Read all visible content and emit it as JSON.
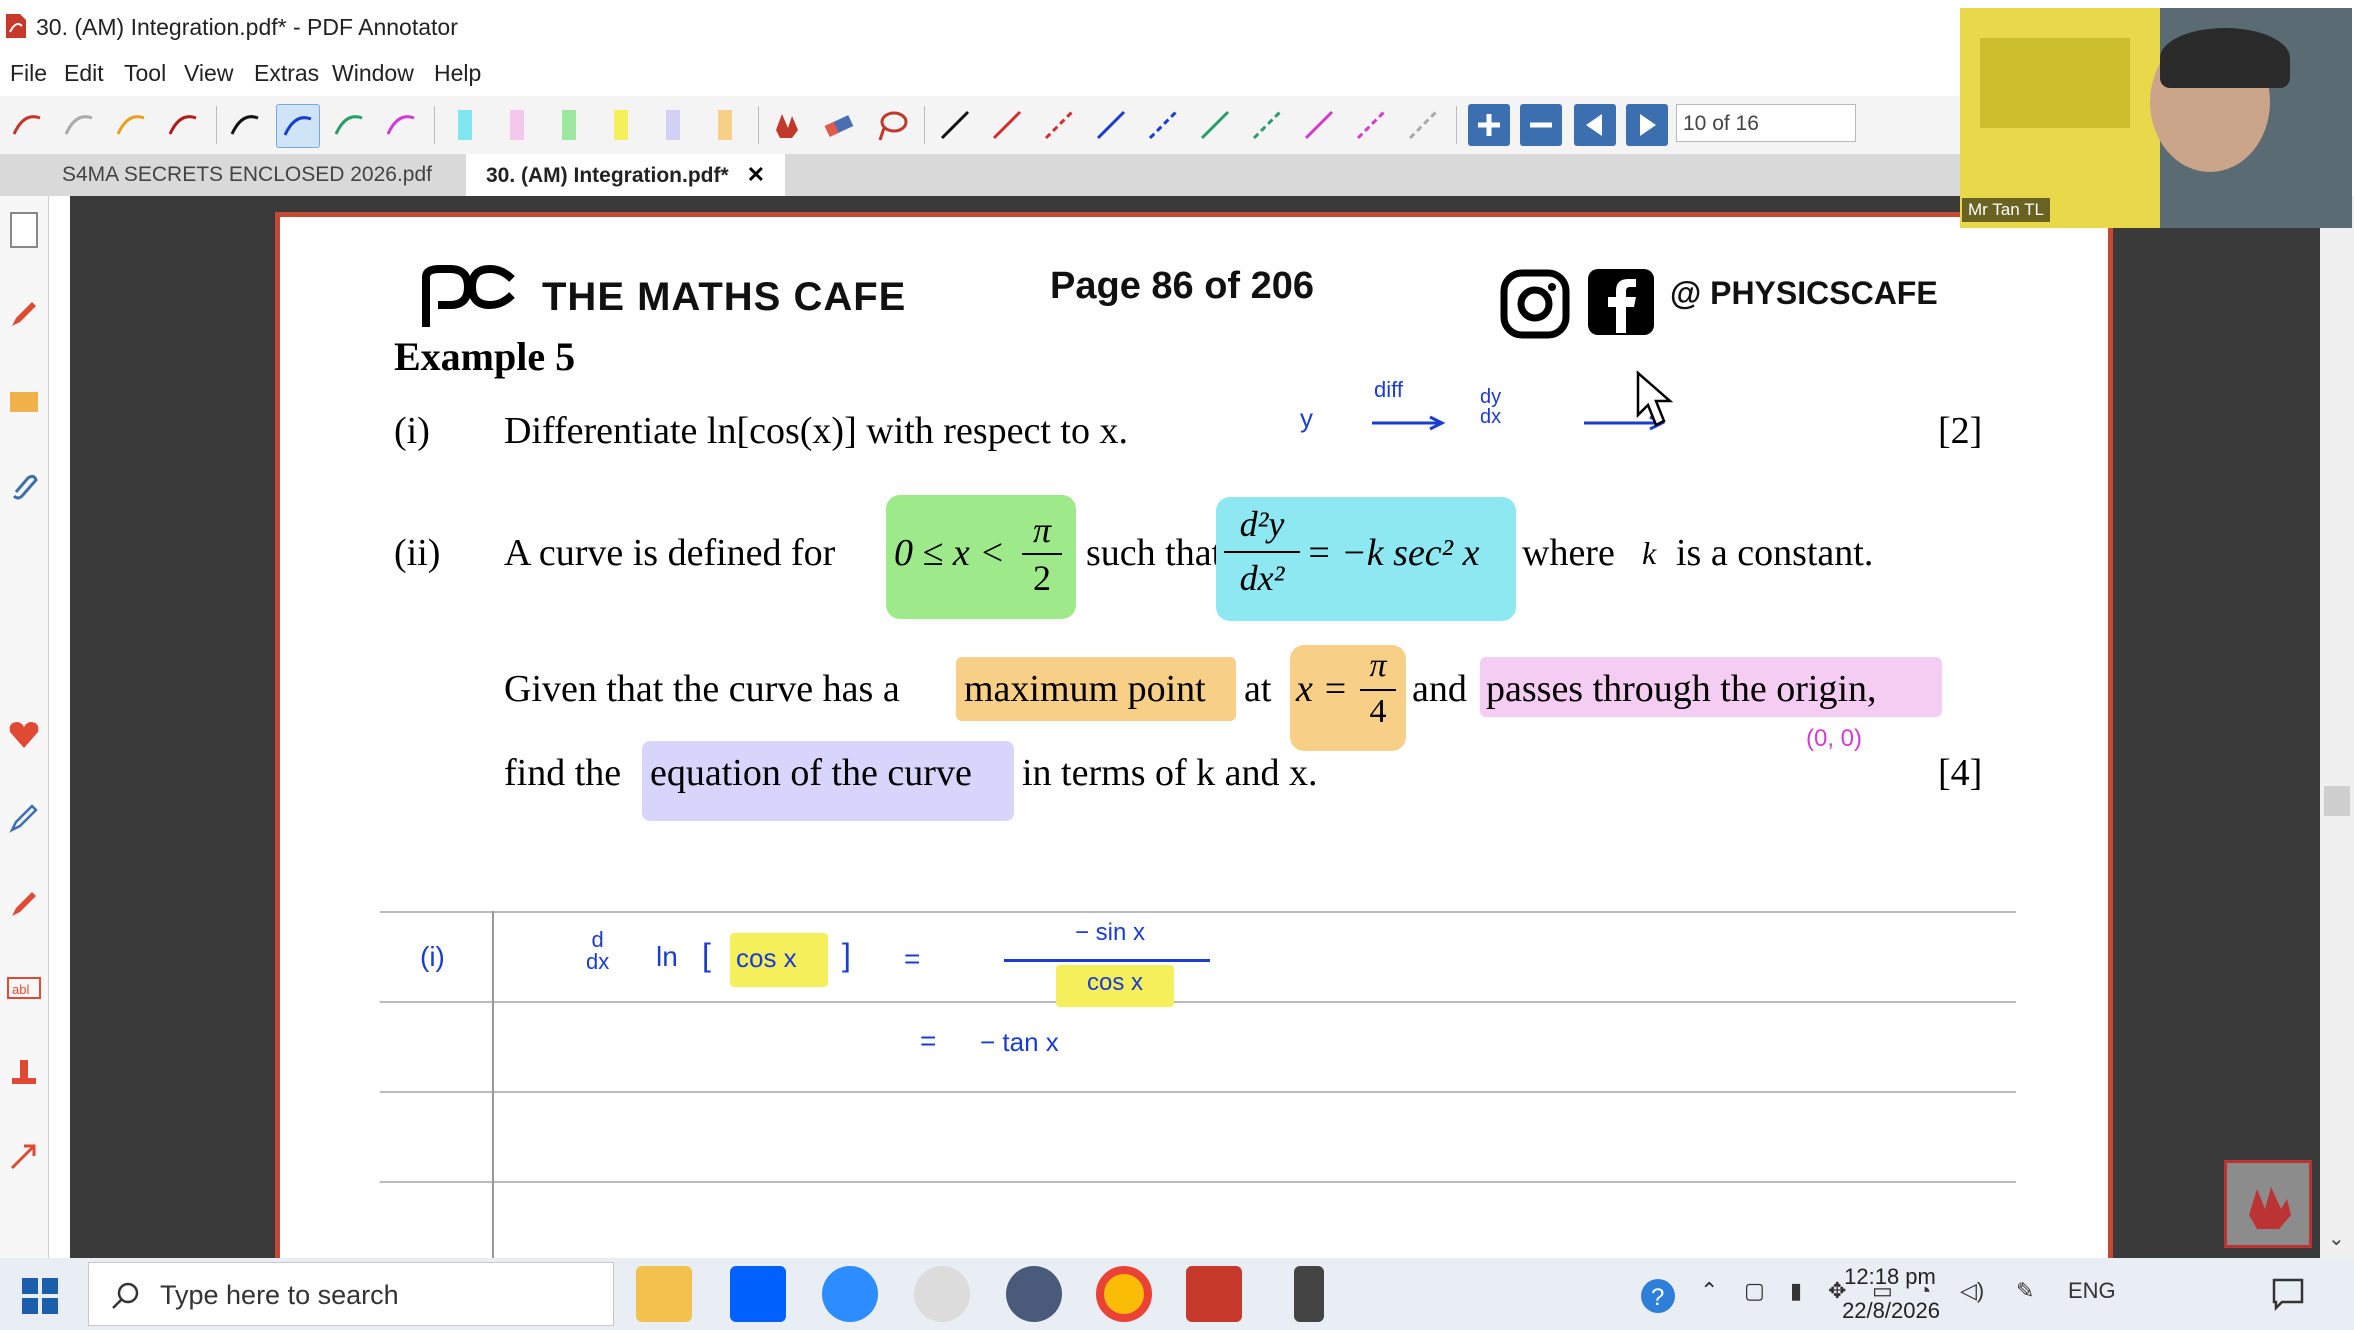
{
  "window": {
    "title": "30. (AM) Integration.pdf* - PDF Annotator"
  },
  "menu": [
    "File",
    "Edit",
    "Tool",
    "View",
    "Extras",
    "Window",
    "Help"
  ],
  "toolbar": {
    "page_indicator": "10 of 16"
  },
  "tabs": [
    {
      "label": "S4MA SECRETS ENCLOSED 2026.pdf"
    },
    {
      "label": "30. (AM) Integration.pdf*",
      "close": "✕"
    }
  ],
  "webcam": {
    "name": "Mr Tan TL"
  },
  "document": {
    "brand": "THE MATHS CAFE",
    "page_label": "Page 86 of 206",
    "social": "@ PHYSICSCAFE",
    "example_title": "Example 5",
    "part_i": {
      "num": "(i)",
      "text": "Differentiate ln[cos(x)] with respect to x.",
      "marks": "[2]"
    },
    "part_ii": {
      "num": "(ii)",
      "line1_a": "A curve is defined for",
      "domain_left": "0 ≤ x <",
      "pi": "π",
      "two": "2",
      "line1_b": "such that",
      "d2y": "d²y",
      "dx2": "dx²",
      "rhs": "= −k sec² x",
      "line1_c": "where",
      "k": "k",
      "line1_d": "is a constant.",
      "line2_a": "Given that the curve has a",
      "maximum_point": "maximum point",
      "at": "at",
      "x_eq": "x =",
      "four": "4",
      "and": "and",
      "passes": "passes through the origin,",
      "line3_a": "find the",
      "eq_curve": "equation of the curve",
      "line3_b": "in terms of k and x.",
      "marks": "[4]"
    },
    "ink": {
      "y": "y",
      "diff": "diff",
      "dydx_top": "dy",
      "dydx_bot": "dx",
      "origin": "(0, 0)",
      "row_label": "(i)",
      "d_top": "d",
      "d_bot": "dx",
      "ln": "ln",
      "lbr": "[",
      "cosx": "cos x",
      "rbr": "]",
      "eq": "=",
      "num": "− sin x",
      "den": "cos x",
      "eq2": "=",
      "result": "− tan x"
    }
  },
  "taskbar": {
    "search_placeholder": "Type here to search",
    "lang": "ENG",
    "time": "12:18 pm",
    "date": "22/8/2026"
  }
}
